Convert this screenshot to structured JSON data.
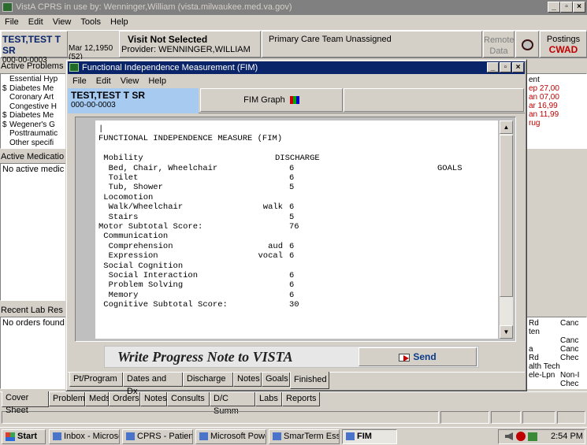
{
  "main_window": {
    "title": "VistA CPRS in use by: Wenninger,William  (vista.milwaukee.med.va.gov)",
    "menu": [
      "File",
      "Edit",
      "View",
      "Tools",
      "Help"
    ],
    "patient_name": "TEST,TEST T SR",
    "patient_id": "000-00-0003",
    "patient_dob": "Mar 12,1950 (52)",
    "visit_title": "Visit Not Selected",
    "visit_provider": "Provider:  WENNINGER,WILLIAM",
    "team": "Primary Care Team Unassigned",
    "remote_data": "Remote Data",
    "postings_label": "Postings",
    "postings_value": "CWAD",
    "active_problems_label": "Active Problems",
    "problems": [
      {
        "flag": "",
        "text": "Essential Hyp"
      },
      {
        "flag": "$",
        "text": "Diabetes Me"
      },
      {
        "flag": "",
        "text": "Coronary Art"
      },
      {
        "flag": "",
        "text": "Congestive H"
      },
      {
        "flag": "$",
        "text": "Diabetes Me"
      },
      {
        "flag": "$",
        "text": "Wegener's G"
      },
      {
        "flag": "",
        "text": "Posttraumatic"
      },
      {
        "flag": "",
        "text": "Other specifi"
      }
    ],
    "active_meds_label": "Active Medicatio",
    "active_meds_text": "No active medic",
    "recent_labs_label": "Recent Lab Res",
    "recent_labs_text": "No orders found",
    "right_top_lines": [
      "ent",
      "ep 27,00",
      "an 07,00",
      "ar 16,99",
      "an 11,99",
      "rug"
    ],
    "right_bottom_rows": [
      [
        "Rd",
        "Canc"
      ],
      [
        "ten",
        ""
      ],
      [
        "",
        "Canc"
      ],
      [
        "a",
        "Canc"
      ],
      [
        "Rd",
        "Chec"
      ],
      [
        "alth Tech",
        ""
      ],
      [
        "ele-Lpn",
        "Non-I"
      ],
      [
        "",
        "Chec"
      ]
    ],
    "tabs": [
      "Cover Sheet",
      "Problems",
      "Meds",
      "Orders",
      "Notes",
      "Consults",
      "D/C Summ",
      "Labs",
      "Reports"
    ]
  },
  "fim_window": {
    "title": "Functional Independence Measurement (FIM)",
    "menu": [
      "File",
      "Edit",
      "View",
      "Help"
    ],
    "patient_name": "TEST,TEST T SR",
    "patient_id": "000-00-0003",
    "graph_button": "FIM Graph",
    "report_header": "FUNCTIONAL INDEPENDENCE MEASURE (FIM)",
    "col_discharge": "DISCHARGE",
    "col_goals": "GOALS",
    "report_lines": [
      {
        "label": " Mobility",
        "mode": "",
        "value": ""
      },
      {
        "label": "  Bed, Chair, Wheelchair",
        "mode": "",
        "value": "6"
      },
      {
        "label": "  Toilet",
        "mode": "",
        "value": "6"
      },
      {
        "label": "  Tub, Shower",
        "mode": "",
        "value": "5"
      },
      {
        "label": " Locomotion",
        "mode": "",
        "value": ""
      },
      {
        "label": "  Walk/Wheelchair",
        "mode": "walk",
        "value": "6"
      },
      {
        "label": "  Stairs",
        "mode": "",
        "value": "5"
      },
      {
        "label": "Motor Subtotal Score:",
        "mode": "",
        "value": "76"
      },
      {
        "label": " Communication",
        "mode": "",
        "value": ""
      },
      {
        "label": "  Comprehension",
        "mode": "aud",
        "value": "6"
      },
      {
        "label": "  Expression",
        "mode": "vocal",
        "value": "6"
      },
      {
        "label": " Social Cognition",
        "mode": "",
        "value": ""
      },
      {
        "label": "  Social Interaction",
        "mode": "",
        "value": "6"
      },
      {
        "label": "  Problem Solving",
        "mode": "",
        "value": "6"
      },
      {
        "label": "  Memory",
        "mode": "",
        "value": "6"
      },
      {
        "label": " Cognitive Subtotal Score:",
        "mode": "",
        "value": "30"
      }
    ],
    "write_note": "Write Progress Note to VISTA",
    "send_button": "Send",
    "tabs": [
      "Pt/Program",
      "Dates and Dx",
      "Discharge",
      "Notes",
      "Goals",
      "Finished"
    ],
    "active_tab": "Finished"
  },
  "taskbar": {
    "start": "Start",
    "items": [
      "Inbox - Microsoft...",
      "CPRS - Patient C...",
      "Microsoft PowerP...",
      "SmarTerm Essent...",
      "FIM"
    ],
    "active_item": "FIM",
    "clock": "2:54 PM"
  },
  "colors": {
    "title_active": "#0a246a",
    "title_inactive": "#808080",
    "selection_blue": "#a6caf0",
    "alert_red": "#c00000"
  }
}
